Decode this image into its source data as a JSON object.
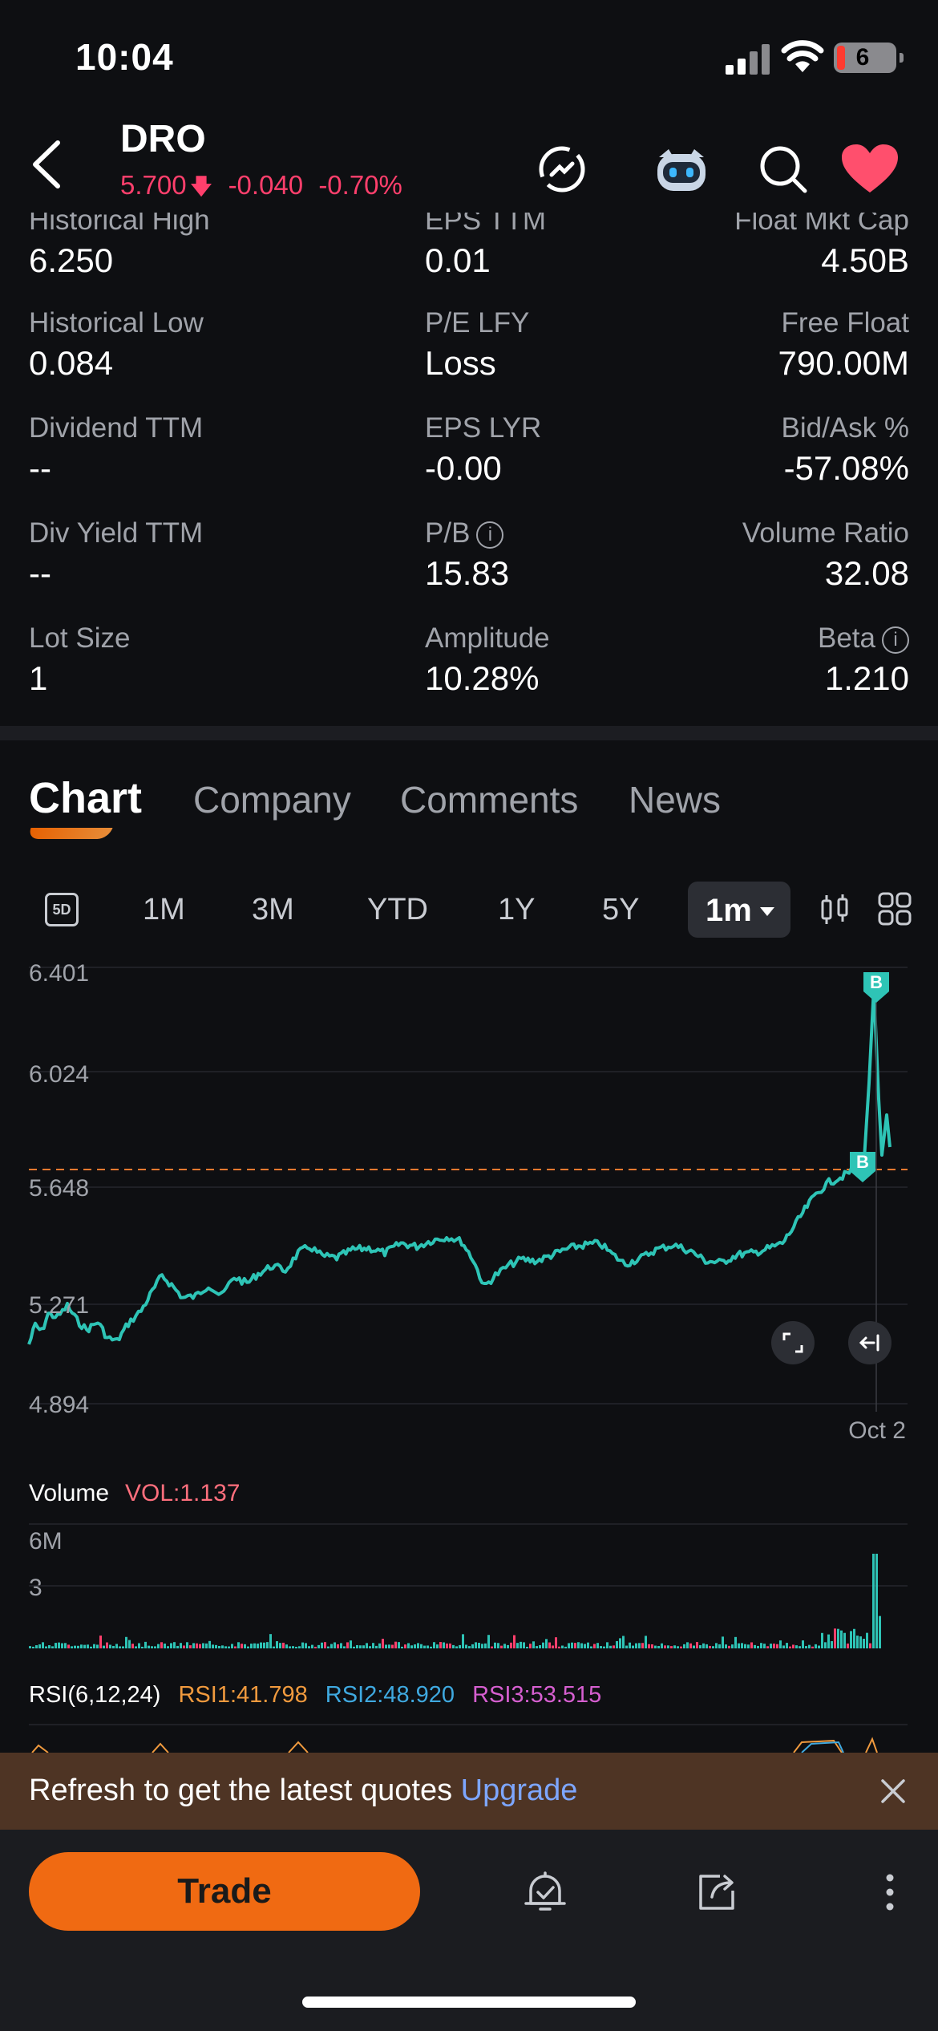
{
  "status_bar": {
    "time": "10:04",
    "battery": "6"
  },
  "header": {
    "ticker": "DRO",
    "price": "5.700",
    "change": "-0.040",
    "change_pct": "-0.70%",
    "icons": [
      "back-icon",
      "refresh-icon",
      "robot-icon",
      "search-icon",
      "heart-icon"
    ]
  },
  "stats": [
    {
      "label": "Historical High",
      "value": "6.250"
    },
    {
      "label": "EPS TTM",
      "value": "0.01"
    },
    {
      "label": "Float Mkt Cap",
      "value": "4.50B"
    },
    {
      "label": "Historical Low",
      "value": "0.084"
    },
    {
      "label": "P/E LFY",
      "value": "Loss"
    },
    {
      "label": "Free Float",
      "value": "790.00M"
    },
    {
      "label": "Dividend TTM",
      "value": "--"
    },
    {
      "label": "EPS LYR",
      "value": "-0.00"
    },
    {
      "label": "Bid/Ask %",
      "value": "-57.08%"
    },
    {
      "label": "Div Yield TTM",
      "value": "--"
    },
    {
      "label": "P/B",
      "value": "15.83"
    },
    {
      "label": "Volume Ratio",
      "value": "32.08"
    },
    {
      "label": "Lot Size",
      "value": "1"
    },
    {
      "label": "Amplitude",
      "value": "10.28%"
    },
    {
      "label": "Beta",
      "value": "1.210"
    }
  ],
  "tabs": [
    "Chart",
    "Company",
    "Comments",
    "News"
  ],
  "ranges": {
    "five_day": "5D",
    "items": [
      "1M",
      "3M",
      "YTD",
      "1Y",
      "5Y"
    ],
    "selected": "1m"
  },
  "chart": {
    "y_ticks": [
      "6.401",
      "6.024",
      "5.648",
      "5.271",
      "4.894"
    ],
    "date_label": "Oct 2",
    "marker_label": "B",
    "line_color": "#2ec4b6",
    "ref_line_color": "#ff7a2f"
  },
  "volume": {
    "title": "Volume",
    "value": "VOL:1.137",
    "ticks": [
      "6M",
      "3"
    ]
  },
  "rsi": {
    "title": "RSI(6,12,24)",
    "rsi1": "RSI1:41.798",
    "rsi2": "RSI2:48.920",
    "rsi3": "RSI3:53.515"
  },
  "banner": {
    "text": "Refresh to get the latest quotes",
    "link": "Upgrade"
  },
  "bottom": {
    "trade": "Trade"
  },
  "colors": {
    "up": "#2ec4b6",
    "down": "#ff3f6c",
    "accent": "#f06a12"
  }
}
